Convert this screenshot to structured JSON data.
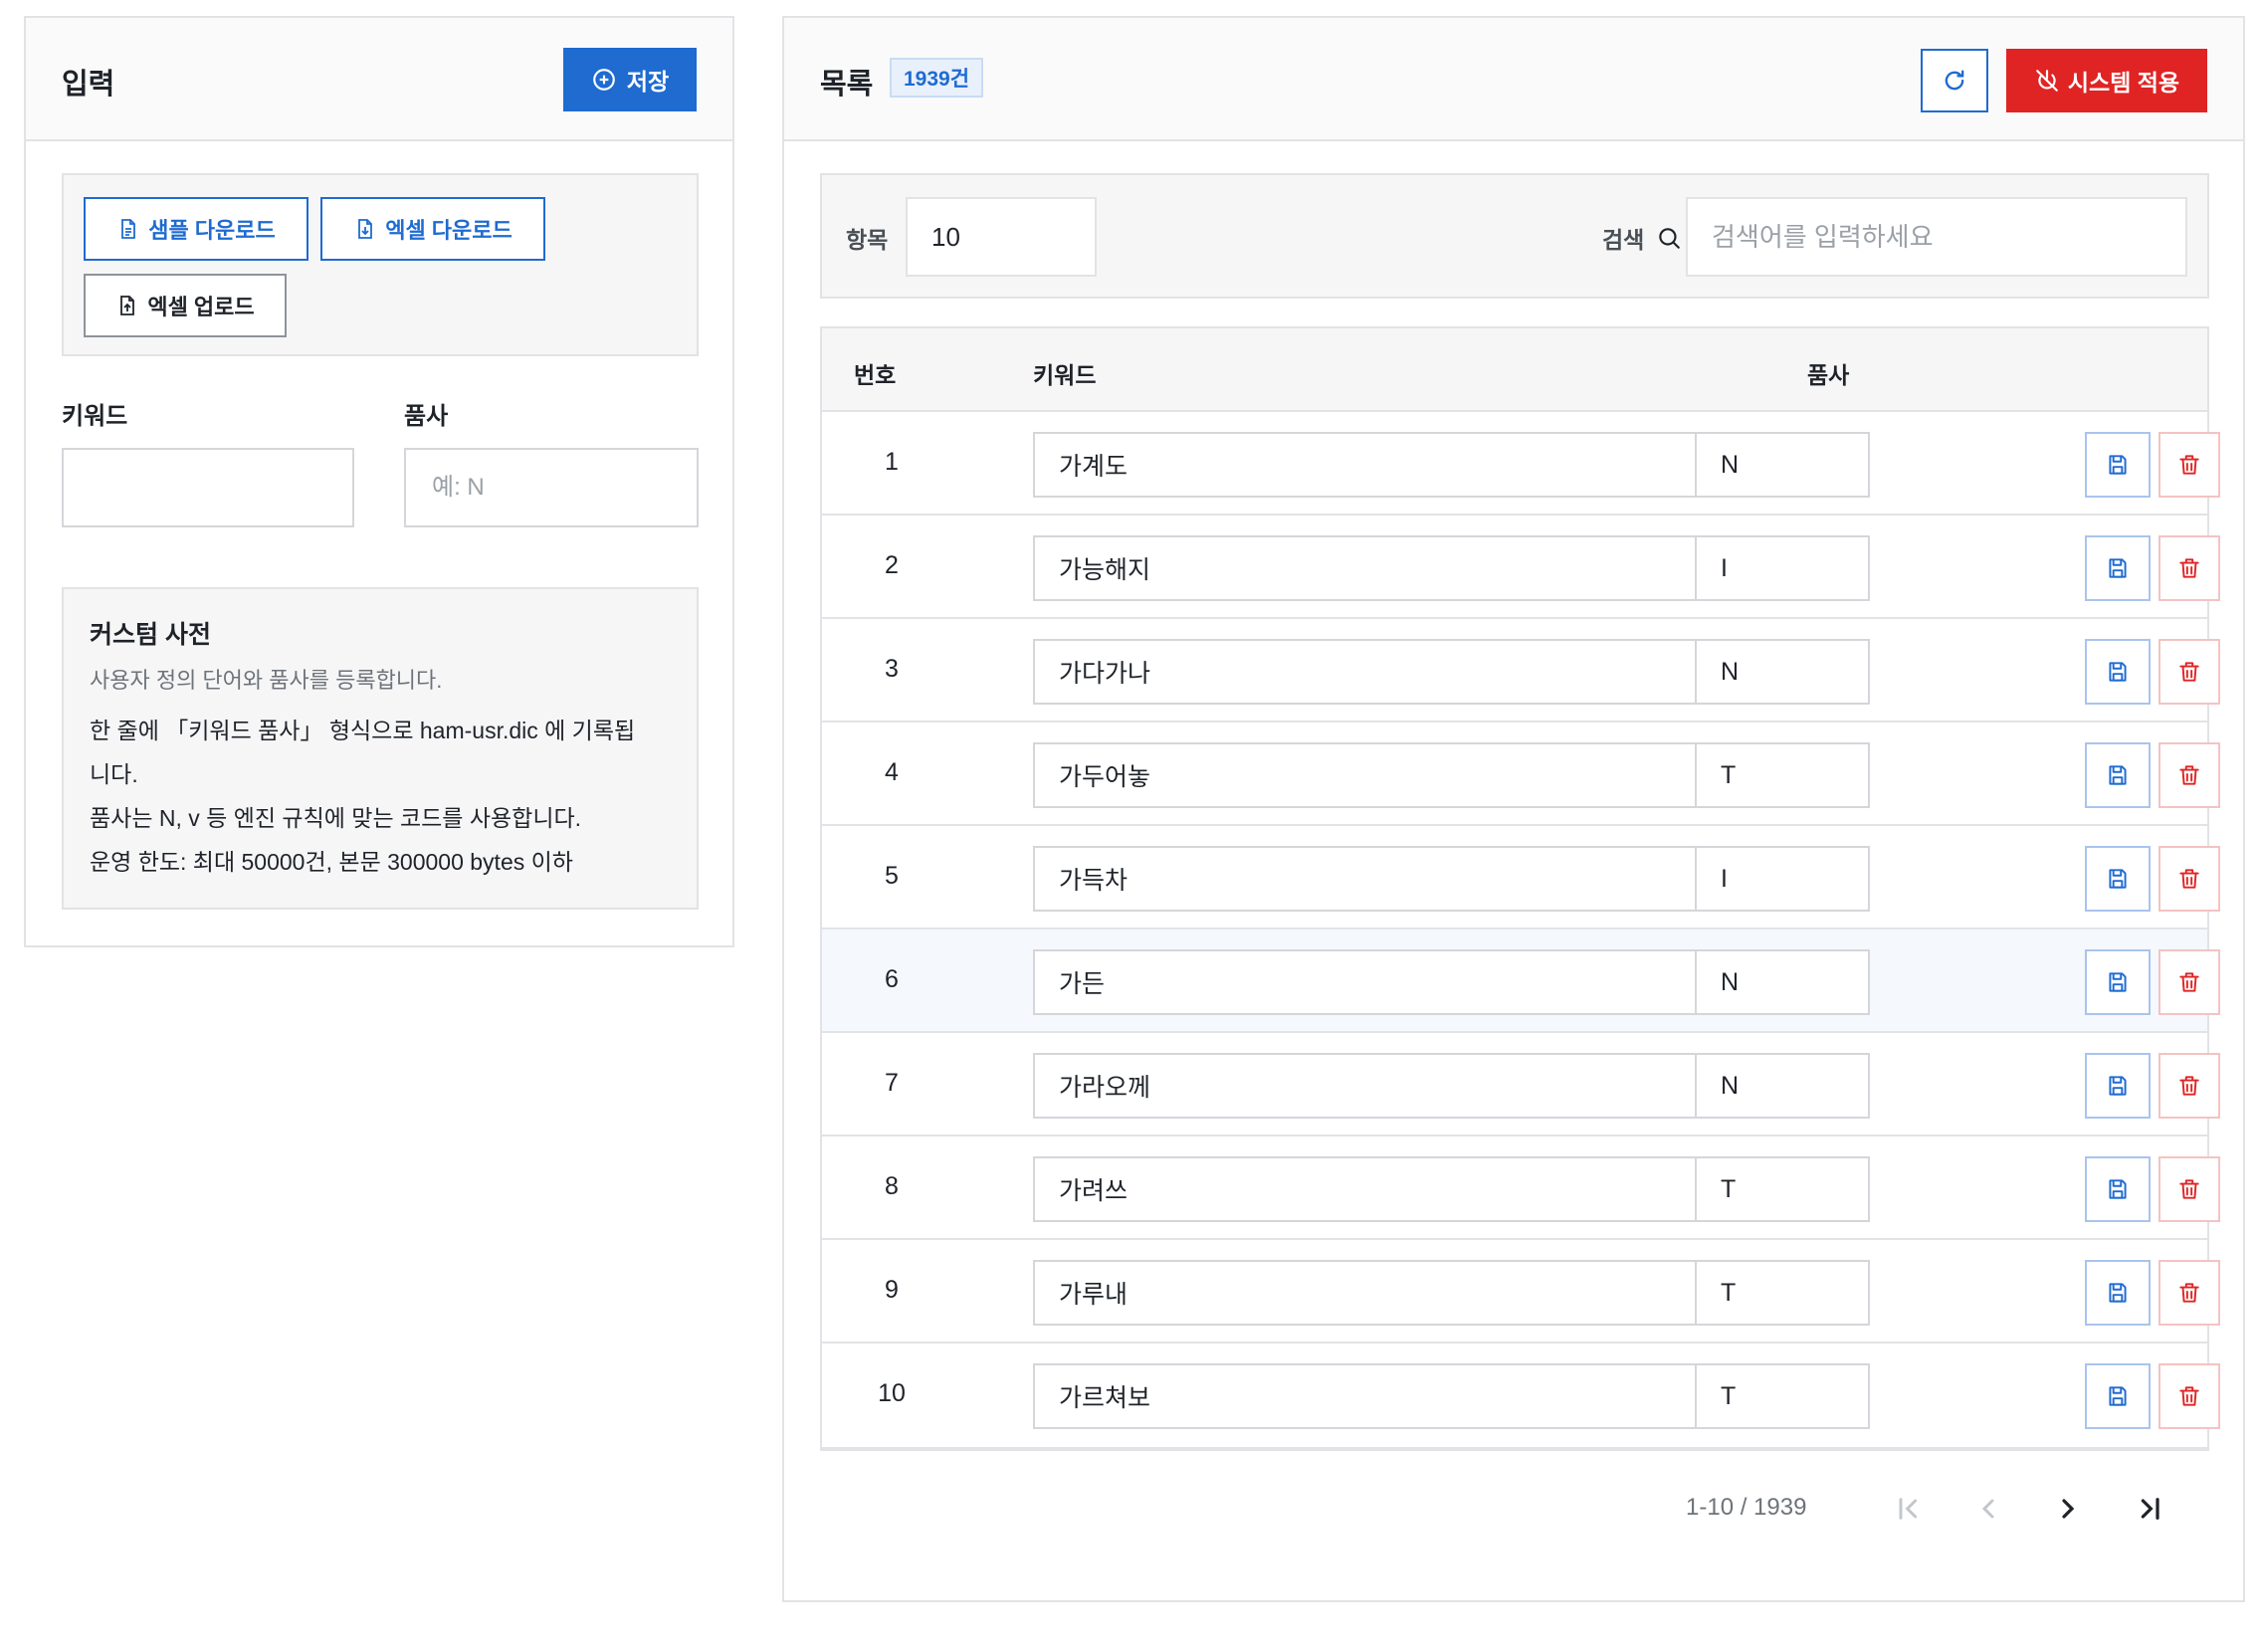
{
  "input_panel": {
    "title": "입력",
    "save_label": "저장",
    "sample_download_label": "샘플 다운로드",
    "excel_download_label": "엑셀 다운로드",
    "excel_upload_label": "엑셀 업로드",
    "keyword_label": "키워드",
    "keyword_value": "",
    "pos_label": "품사",
    "pos_placeholder": "예: N",
    "info": {
      "title": "커스텀 사전",
      "subtitle": "사용자 정의 단어와 품사를 등록합니다.",
      "line1a": "한 줄에 「키워드 품사」 형식으로 ham-usr.dic 에 기록됩",
      "line1b": "니다.",
      "line2": "품사는 N, v 등 엔진 규칙에 맞는 코드를 사용합니다.",
      "line3": "운영 한도: 최대 50000건, 본문 300000 bytes 이하"
    }
  },
  "list_panel": {
    "title": "목록",
    "count_badge": "1939건",
    "apply_label": "시스템 적용",
    "items_label": "항목",
    "items_value": "10",
    "search_label": "검색",
    "search_placeholder": "검색어를 입력하세요",
    "columns": {
      "num": "번호",
      "keyword": "키워드",
      "pos": "품사"
    },
    "rows": [
      {
        "num": "1",
        "keyword": "가계도",
        "pos": "N"
      },
      {
        "num": "2",
        "keyword": "가능해지",
        "pos": "I"
      },
      {
        "num": "3",
        "keyword": "가다가나",
        "pos": "N"
      },
      {
        "num": "4",
        "keyword": "가두어놓",
        "pos": "T"
      },
      {
        "num": "5",
        "keyword": "가득차",
        "pos": "I"
      },
      {
        "num": "6",
        "keyword": "가든",
        "pos": "N"
      },
      {
        "num": "7",
        "keyword": "가라오께",
        "pos": "N"
      },
      {
        "num": "8",
        "keyword": "가려쓰",
        "pos": "T"
      },
      {
        "num": "9",
        "keyword": "가루내",
        "pos": "T"
      },
      {
        "num": "10",
        "keyword": "가르쳐보",
        "pos": "T"
      }
    ],
    "pagination_info": "1-10 / 1939"
  },
  "colors": {
    "primary": "#1f6bd0",
    "danger": "#e02424",
    "border": "#e1e3e6",
    "panel_bg": "#f6f6f7",
    "row_hover": "#f5f8fd"
  },
  "icons": {
    "save": "plus-circle-icon",
    "file": "document-icon",
    "download": "file-download-icon",
    "upload": "file-upload-icon",
    "refresh": "refresh-icon",
    "apply": "power-off-icon",
    "search": "search-icon",
    "row_save": "floppy-disk-icon",
    "row_delete": "trash-icon",
    "pager": [
      "first-page-icon",
      "prev-page-icon",
      "next-page-icon",
      "last-page-icon"
    ]
  }
}
